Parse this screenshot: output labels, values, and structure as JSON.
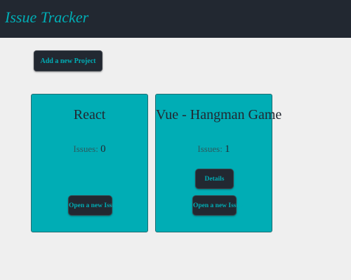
{
  "navbar": {
    "brand": "Issue Tracker"
  },
  "toolbar": {
    "add_project_label": "Add a new Project"
  },
  "projects": [
    {
      "name": "React",
      "issues_label": "Issues:",
      "issues_count": "0",
      "open_issue_label": "Open a new Issue"
    },
    {
      "name": "Vue - Hangman Game",
      "issues_label": "Issues:",
      "issues_count": "1",
      "details_label": "Details",
      "open_issue_label": "Open a new Issue"
    }
  ],
  "colors": {
    "navbar_bg": "#222831",
    "accent": "#00adb5",
    "page_bg": "#efefef"
  }
}
